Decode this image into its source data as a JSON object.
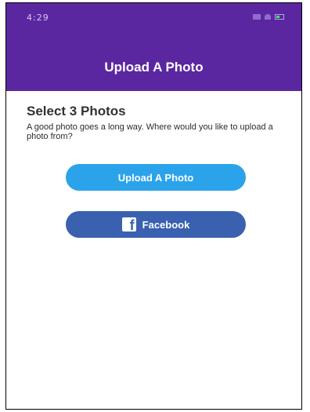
{
  "status_bar": {
    "time": "4:29"
  },
  "header": {
    "title": "Upload A Photo"
  },
  "content": {
    "section_title": "Select 3 Photos",
    "description": "A good photo goes a long way. Where would you like to upload a photo from?"
  },
  "buttons": {
    "upload_label": "Upload A Photo",
    "facebook_label": "Facebook"
  },
  "icons": {
    "facebook": "facebook-icon",
    "signal": "signal-icon",
    "wifi": "wifi-icon",
    "battery": "battery-icon"
  },
  "colors": {
    "header_bg": "#5a27a0",
    "upload_button": "#2aa3ea",
    "facebook_button": "#3a60b0"
  }
}
